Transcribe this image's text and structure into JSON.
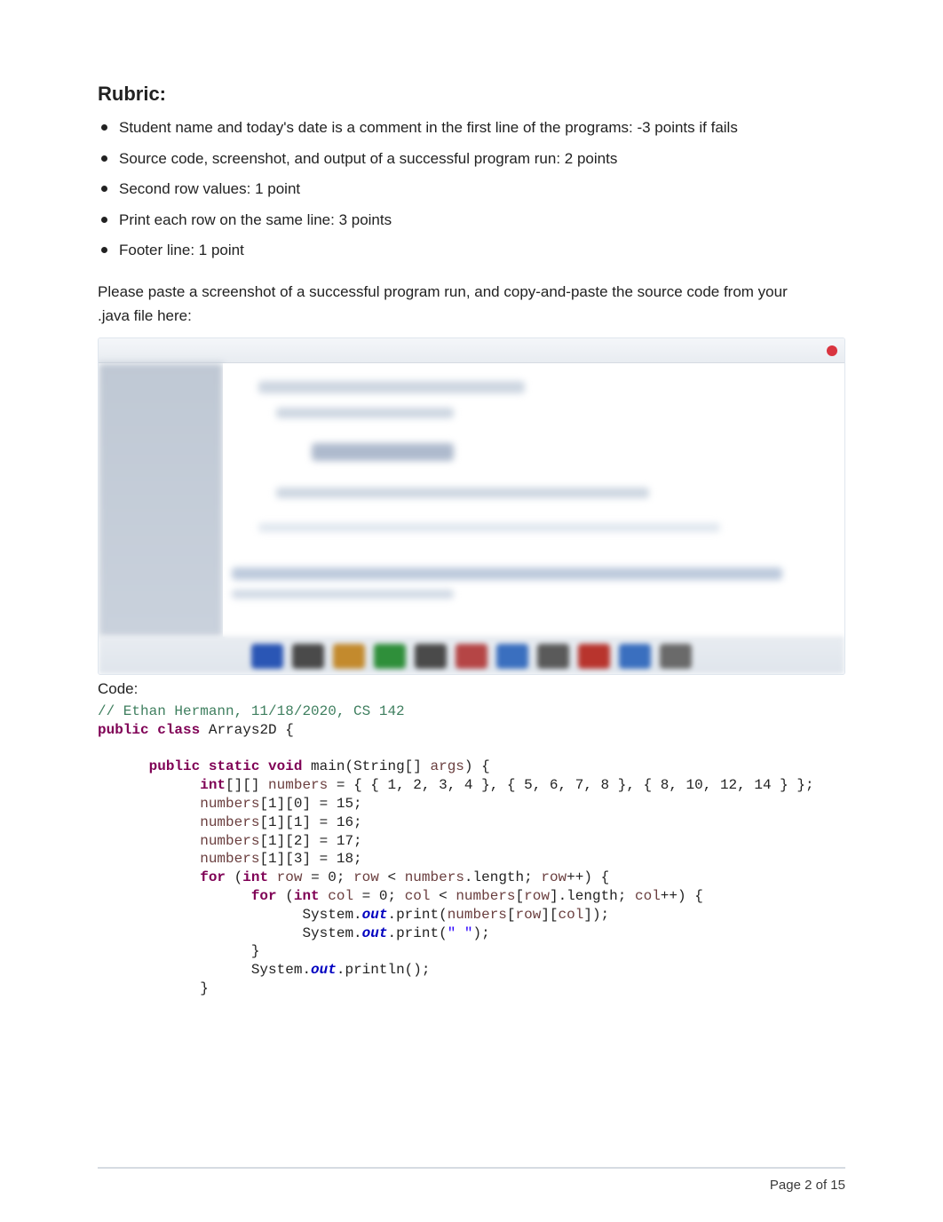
{
  "rubric": {
    "heading": "Rubric:",
    "items": [
      "Student name and today's date is a comment in the first line of the programs: -3 points if fails",
      "Source code, screenshot, and output of a successful program run: 2 points",
      "Second row values: 1 point",
      "Print each row on the same line: 3 points",
      "Footer line: 1 point"
    ]
  },
  "instruction": {
    "line1": "Please paste a screenshot of a successful program run, and copy-and-paste the source code from your",
    "line2": ".java file here:"
  },
  "code_label": "Code:",
  "code": {
    "comment": "// Ethan Hermann, 11/18/2020, CS 142",
    "kw_public": "public",
    "kw_class": "class",
    "class_name": " Arrays2D {",
    "kw_static": "static",
    "kw_void": "void",
    "main_sig_mid": " main(String[] ",
    "param_args": "args",
    "main_sig_end": ") {",
    "kw_int": "int",
    "decl_mid": "[][] ",
    "var_numbers": "numbers",
    "decl_vals": " = { { 1, 2, 3, 4 }, { 5, 6, 7, 8 }, { 8, 10, 12, 14 } };",
    "assign_a": "[1][0] = 15;",
    "assign_b": "[1][1] = 16;",
    "assign_c": "[1][2] = 17;",
    "assign_d": "[1][3] = 18;",
    "kw_for": "for",
    "for_outer_a": " (",
    "var_row": "row",
    "for_outer_b": " = 0; ",
    "for_outer_c": " < ",
    "dot_length": ".length",
    "for_outer_d": "; ",
    "for_outer_e": "++) {",
    "var_col": "col",
    "for_inner_b": " = 0; ",
    "for_inner_c": " < ",
    "bracket_row_a": "[",
    "bracket_row_b": "]",
    "for_inner_d": "; ",
    "for_inner_e": "++) {",
    "sys": "System.",
    "field_out": "out",
    "print_a": ".print(",
    "print_b": "[",
    "print_c": "][",
    "print_d": "]);",
    "print_space_a": ".print(",
    "str_space": "\" \"",
    "print_space_b": ");",
    "println": ".println();",
    "brace_close": "}"
  },
  "footer": "Page 2 of 15"
}
